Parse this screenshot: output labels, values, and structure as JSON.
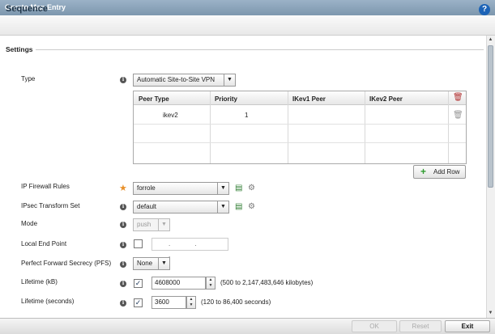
{
  "window": {
    "title": "Crypto Map Entry"
  },
  "header": {
    "title": "Sequence",
    "help_icon": "?"
  },
  "settings": {
    "section_label": "Settings",
    "type": {
      "label": "Type",
      "value": "Automatic Site-to-Site VPN"
    },
    "peer_table": {
      "columns": [
        "Peer Type",
        "Priority",
        "IKev1 Peer",
        "IKev2 Peer"
      ],
      "rows": [
        {
          "peer_type": "ikev2",
          "priority": "1",
          "ikev1_peer": "",
          "ikev2_peer": ""
        }
      ],
      "add_row_label": "Add Row"
    },
    "ip_firewall_rules": {
      "label": "IP Firewall Rules",
      "value": "forrole"
    },
    "ipsec_transform_set": {
      "label": "IPsec Transform Set",
      "value": "default"
    },
    "mode": {
      "label": "Mode",
      "value": "push"
    },
    "local_end_point": {
      "label": "Local End Point",
      "enabled": false,
      "value": ". . ."
    },
    "pfs": {
      "label": "Perfect Forward Secrecy (PFS)",
      "value": "None"
    },
    "lifetime_kb": {
      "label": "Lifetime (kB)",
      "enabled": true,
      "value": "4608000",
      "hint": "(500 to 2,147,483,646 kilobytes)"
    },
    "lifetime_seconds": {
      "label": "Lifetime (seconds)",
      "enabled": true,
      "value": "3600",
      "hint": "(120 to 86,400 seconds)"
    }
  },
  "footer": {
    "ok_label": "OK",
    "reset_label": "Reset",
    "exit_label": "Exit"
  },
  "colors": {
    "title_bar": "#8aa3b9",
    "help_icon": "#1c63b7",
    "required_star": "#e8902a",
    "add_icon": "#2e9b2e",
    "delete_icon": "#b03030"
  }
}
